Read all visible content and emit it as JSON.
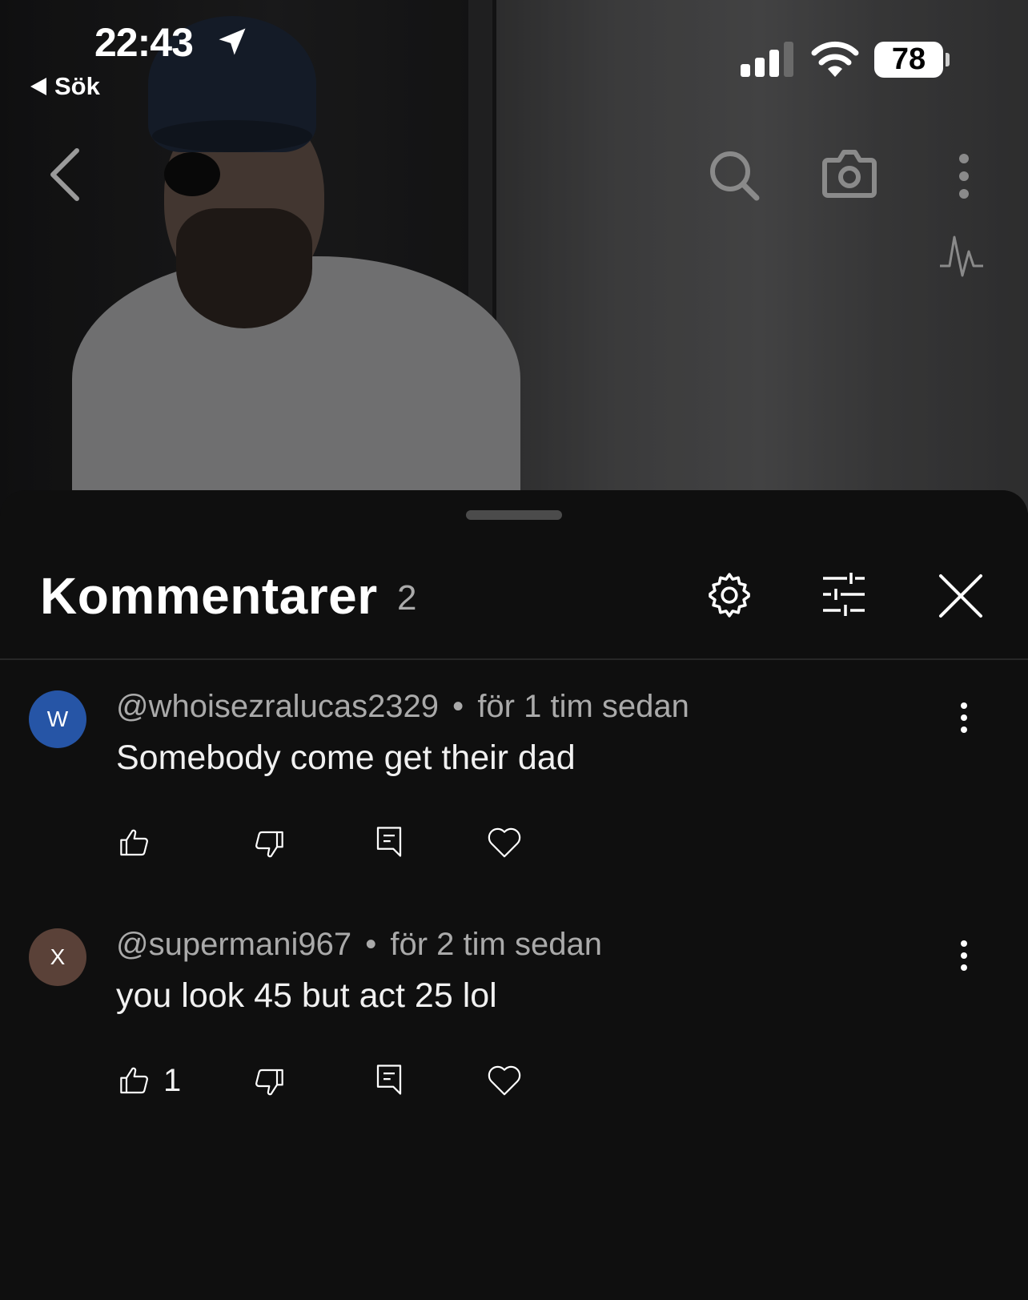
{
  "status_bar": {
    "time": "22:43",
    "back_app_label": "Sök",
    "battery_percent": "78",
    "cellular_bars_active": 3,
    "cellular_bars_total": 4
  },
  "video_overlay": {
    "icons": [
      "chevron-left-icon",
      "search-icon",
      "camera-icon",
      "more-vertical-icon",
      "pulse-icon"
    ]
  },
  "comments_panel": {
    "title": "Kommentarer",
    "count": "2",
    "header_icons": [
      "gear-icon",
      "sliders-icon",
      "close-icon"
    ],
    "comments": [
      {
        "avatar_letter": "W",
        "avatar_color": "#2655a6",
        "author": "@whoisezralucas2329",
        "separator": "•",
        "time": "för 1 tim sedan",
        "text": "Somebody come get their dad",
        "like_count": ""
      },
      {
        "avatar_letter": "X",
        "avatar_color": "#5a4138",
        "author": "@supermani967",
        "separator": "•",
        "time": "för 2 tim sedan",
        "text": "you look 45 but act 25 lol",
        "like_count": "1"
      }
    ]
  },
  "colors": {
    "sheet_background": "#0f0f0f",
    "primary_text": "#f1f1f1",
    "secondary_text": "#aaaaaa"
  }
}
